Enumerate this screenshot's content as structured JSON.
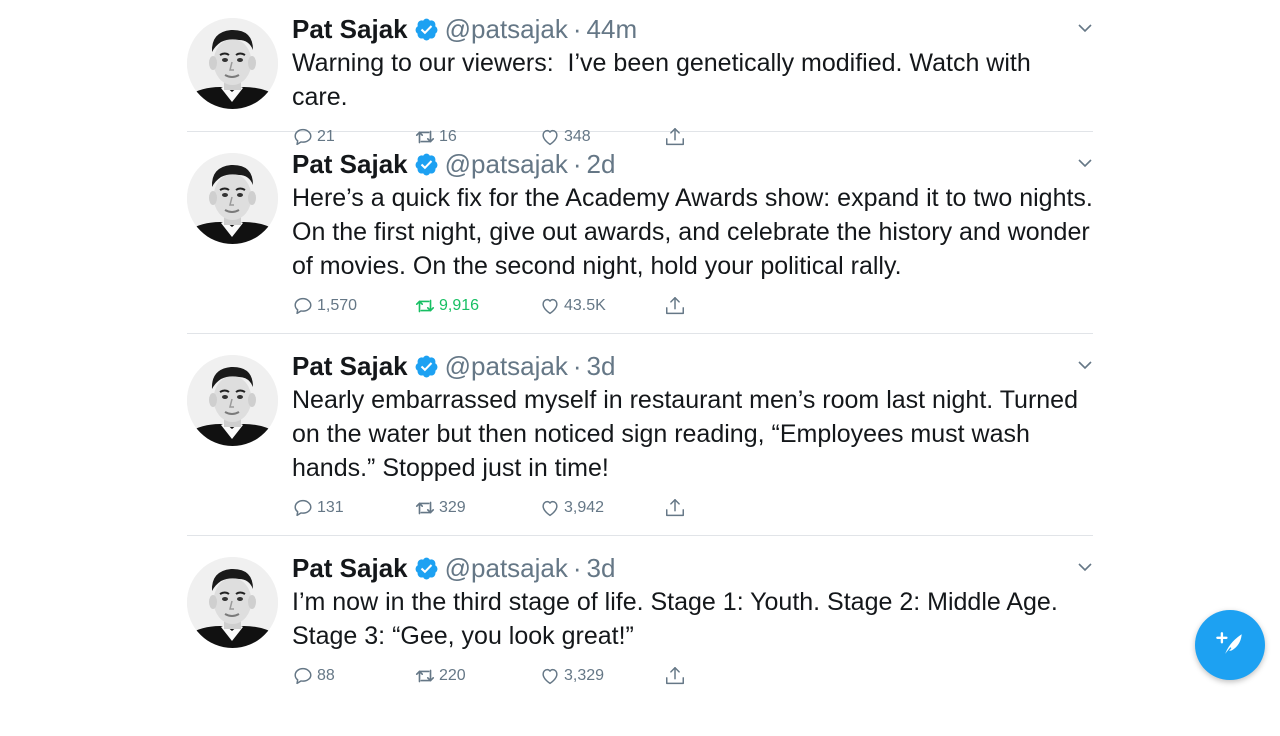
{
  "colors": {
    "accent": "#1da1f2",
    "text": "#14171a",
    "muted": "#657786",
    "retweet_active": "#17bf63"
  },
  "feed": {
    "tweets": [
      {
        "name": "Pat Sajak",
        "verified": true,
        "handle": "@patsajak",
        "separator": "·",
        "time": "44m",
        "text": "Warning to our viewers:  I’ve been genetically modified. Watch with care.",
        "replies": "21",
        "retweets": "16",
        "likes": "348",
        "retweeted": false
      },
      {
        "name": "Pat Sajak",
        "verified": true,
        "handle": "@patsajak",
        "separator": "·",
        "time": "2d",
        "text": "Here’s a quick fix for the Academy Awards show: expand it to two nights. On the first night, give out awards, and celebrate the history and wonder of movies. On the second night, hold your political rally.",
        "replies": "1,570",
        "retweets": "9,916",
        "likes": "43.5K",
        "retweeted": true
      },
      {
        "name": "Pat Sajak",
        "verified": true,
        "handle": "@patsajak",
        "separator": "·",
        "time": "3d",
        "text": "Nearly embarrassed myself in restaurant men’s room last night. Turned on the water but then noticed sign reading, “Employees must wash hands.” Stopped just in time!",
        "replies": "131",
        "retweets": "329",
        "likes": "3,942",
        "retweeted": false
      },
      {
        "name": "Pat Sajak",
        "verified": true,
        "handle": "@patsajak",
        "separator": "·",
        "time": "3d",
        "text": "I’m now in the third stage of life. Stage 1: Youth. Stage 2: Middle Age. Stage 3: “Gee, you look great!”",
        "replies": "88",
        "retweets": "220",
        "likes": "3,329",
        "retweeted": false
      }
    ]
  },
  "icons": {
    "reply": "reply-icon",
    "retweet": "retweet-icon",
    "like": "heart-icon",
    "share": "share-icon",
    "caret": "chevron-down-icon",
    "verified": "verified-badge-icon",
    "compose": "compose-tweet-icon"
  }
}
